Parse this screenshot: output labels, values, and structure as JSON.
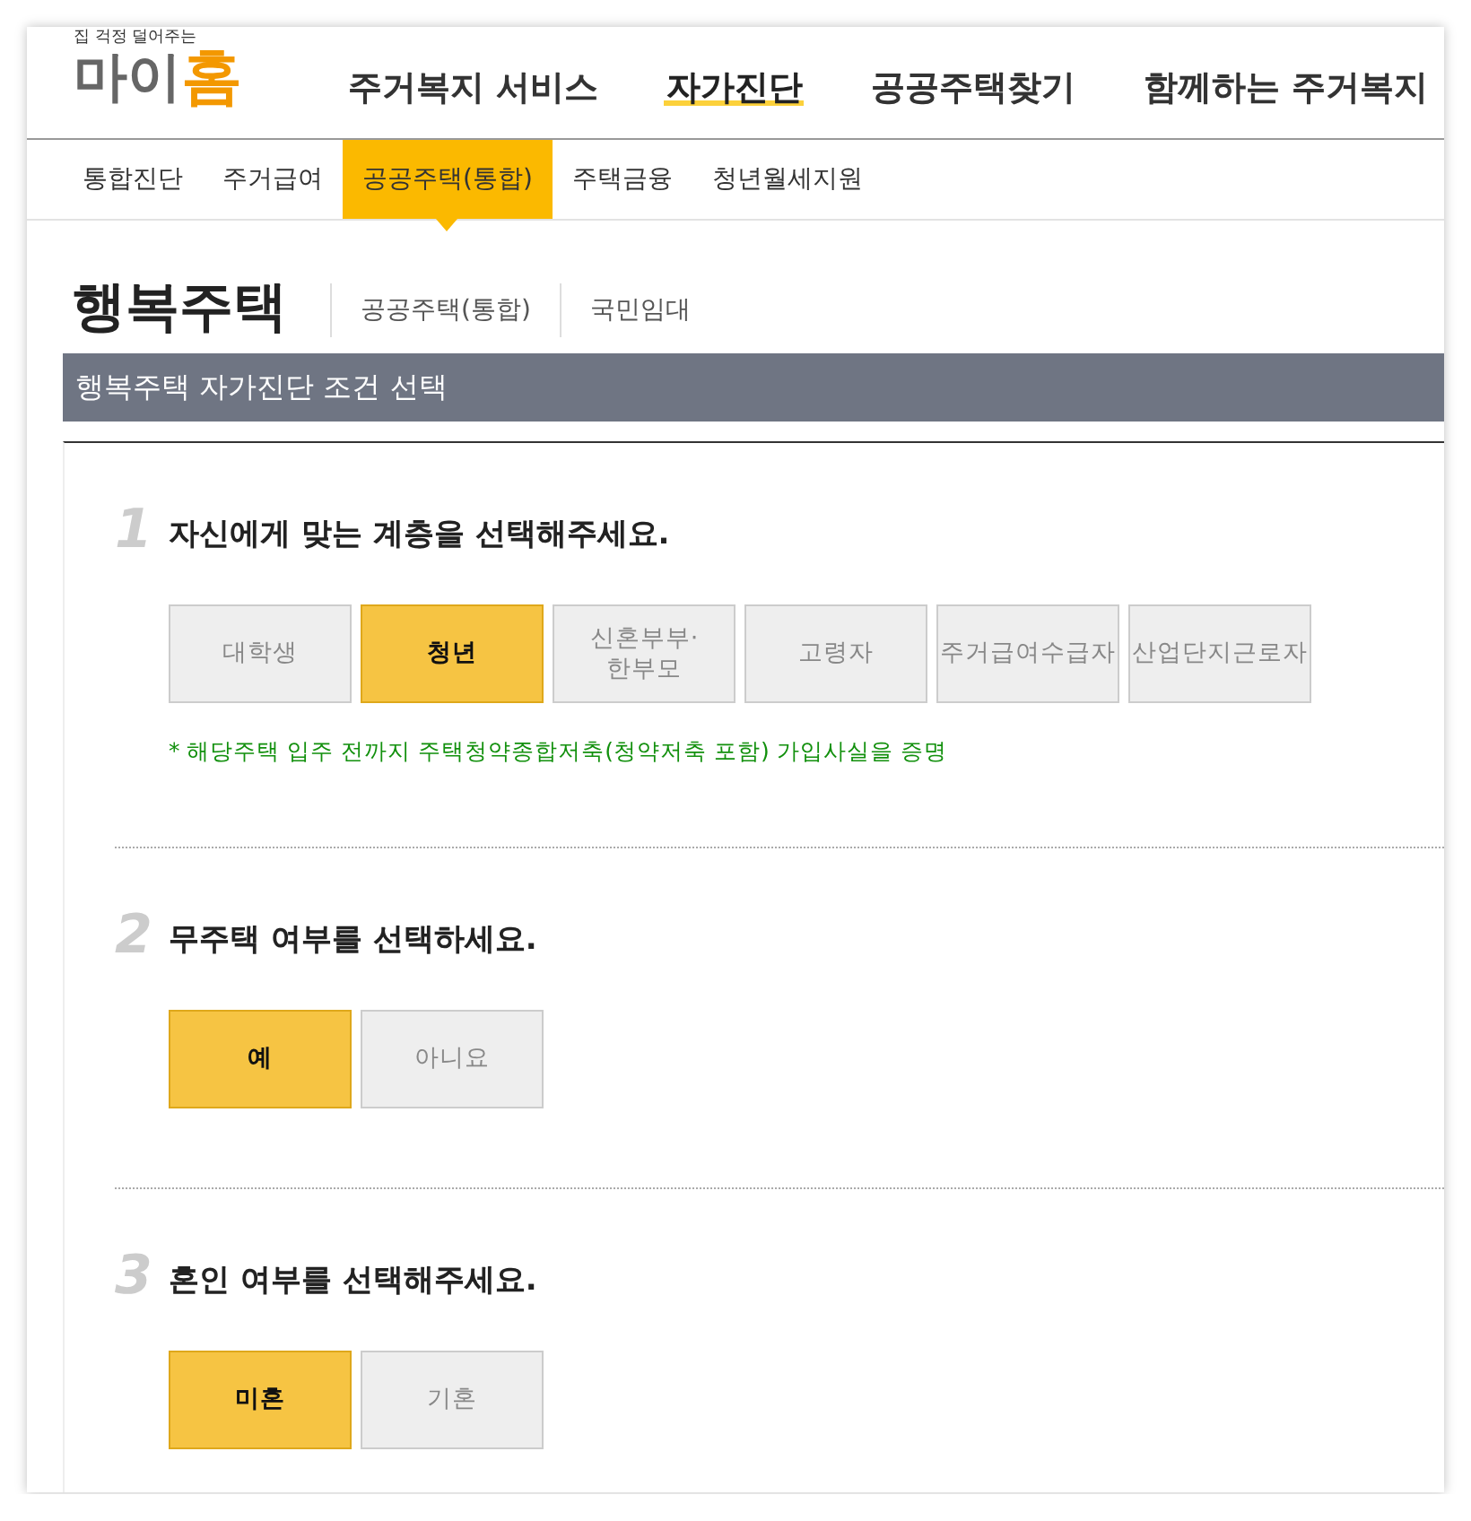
{
  "logo": {
    "tagline": "집 걱정 덜어주는",
    "name_main": "마이",
    "name_accent": "홈"
  },
  "main_nav": [
    {
      "label": "주거복지 서비스",
      "selected": false
    },
    {
      "label": "자가진단",
      "selected": true
    },
    {
      "label": "공공주택찾기",
      "selected": false
    },
    {
      "label": "함께하는 주거복지",
      "selected": false
    }
  ],
  "sub_nav": [
    {
      "label": "통합진단",
      "selected": false
    },
    {
      "label": "주거급여",
      "selected": false
    },
    {
      "label": "공공주택(통합)",
      "selected": true
    },
    {
      "label": "주택금융",
      "selected": false
    },
    {
      "label": "청년월세지원",
      "selected": false
    }
  ],
  "page_title": "행복주택",
  "title_links": [
    "공공주택(통합)",
    "국민임대"
  ],
  "section_bar": "행복주택 자가진단 조건 선택",
  "questions": [
    {
      "number": "1",
      "title": "자신에게 맞는 계층을 선택해주세요.",
      "options": [
        {
          "label": "대학생",
          "selected": false
        },
        {
          "label": "청년",
          "selected": true
        },
        {
          "label": "신혼부부·\n한부모",
          "selected": false
        },
        {
          "label": "고령자",
          "selected": false
        },
        {
          "label": "주거급여수급자",
          "selected": false
        },
        {
          "label": "산업단지근로자",
          "selected": false
        }
      ],
      "note": "* 해당주택 입주 전까지 주택청약종합저축(청약저축 포함) 가입사실을 증명"
    },
    {
      "number": "2",
      "title": "무주택 여부를 선택하세요.",
      "options": [
        {
          "label": "예",
          "selected": true
        },
        {
          "label": "아니요",
          "selected": false
        }
      ]
    },
    {
      "number": "3",
      "title": "혼인 여부를 선택해주세요.",
      "options": [
        {
          "label": "미혼",
          "selected": true
        },
        {
          "label": "기혼",
          "selected": false
        }
      ]
    }
  ]
}
